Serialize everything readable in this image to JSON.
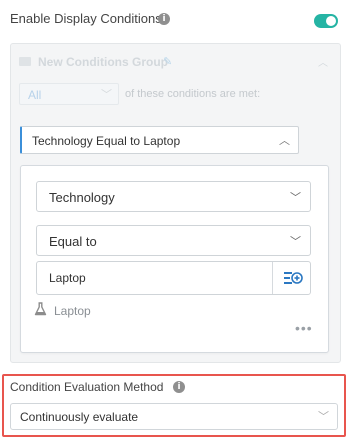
{
  "header": {
    "title": "Enable Display Conditions",
    "info_icon": "info-icon",
    "toggle_on": true,
    "toggle_color": "#25b4a4"
  },
  "group": {
    "title": "New Conditions Group",
    "edit_icon": "pencil-icon",
    "collapse_icon": "chevron-up-icon",
    "match_select": {
      "value": "All"
    },
    "match_suffix": "of these conditions are met:"
  },
  "condition": {
    "summary": "Technology Equal to Laptop",
    "field_select": {
      "value": "Technology"
    },
    "operator_select": {
      "value": "Equal to"
    },
    "value_input": {
      "value": "Laptop"
    },
    "add_value_icon": "list-add-icon",
    "preview_icon": "flask-icon",
    "preview_value": "Laptop",
    "more_menu": "•••",
    "accent_color": "#3b8fd9"
  },
  "evaluation": {
    "label": "Condition Evaluation Method",
    "select": {
      "value": "Continuously evaluate"
    },
    "highlight_color": "#e8554e"
  }
}
